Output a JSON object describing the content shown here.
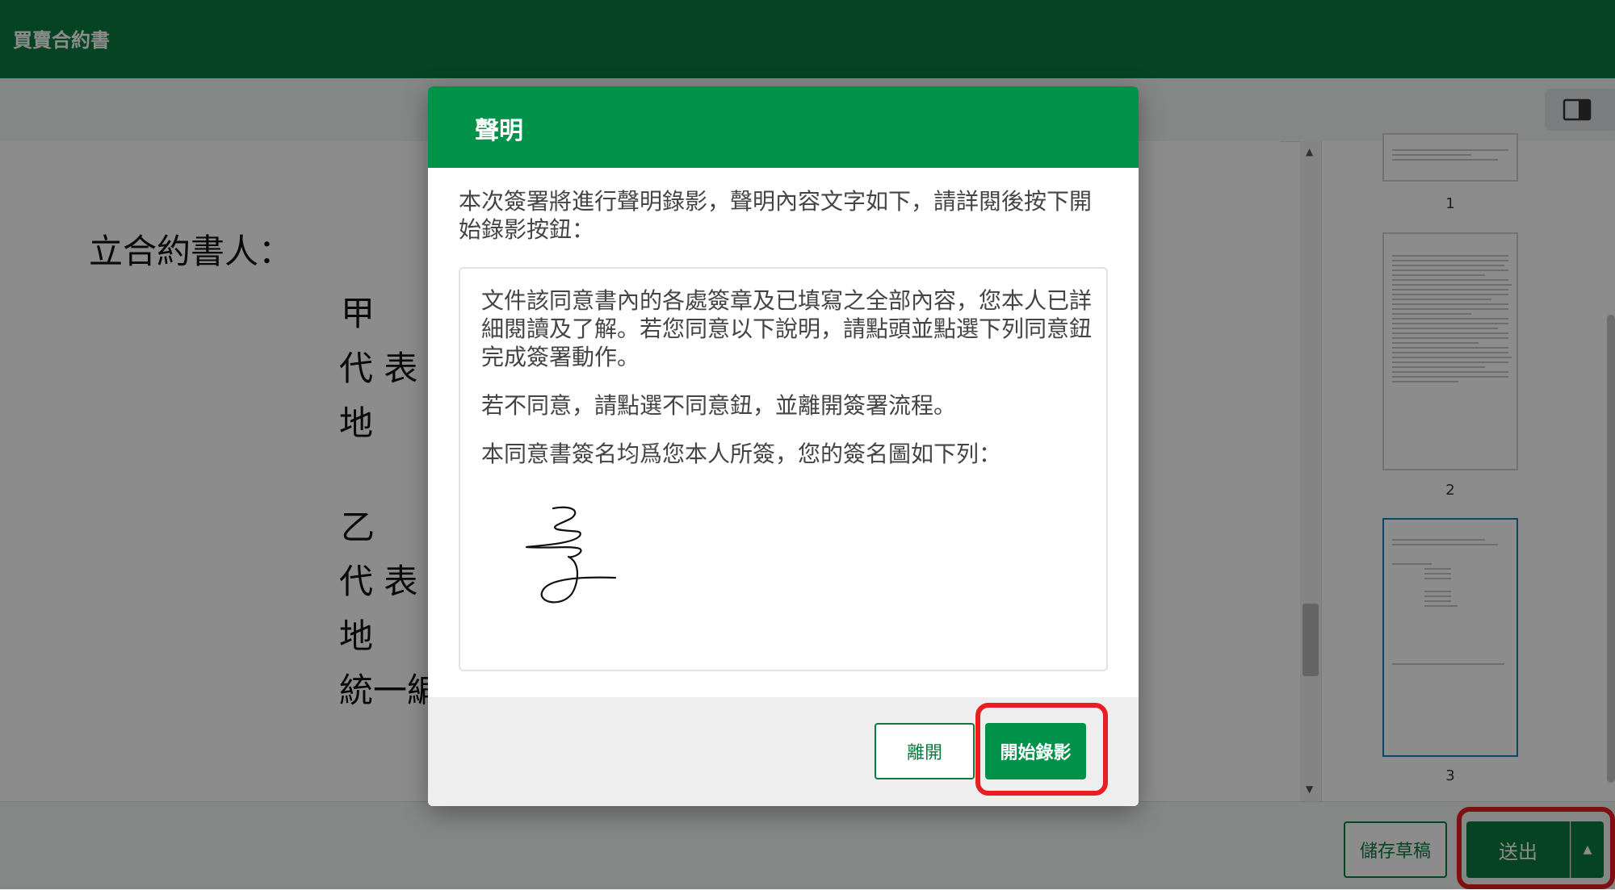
{
  "app": {
    "title": "買賣合約書"
  },
  "document": {
    "lines": [
      "立合約書人：",
      "甲",
      "代 表",
      "地",
      "乙",
      "代 表",
      "地",
      "統一編"
    ]
  },
  "thumbnails": [
    {
      "page": "1"
    },
    {
      "page": "2"
    },
    {
      "page": "3"
    }
  ],
  "footer": {
    "save_draft_label": "儲存草稿",
    "send_label": "送出"
  },
  "modal": {
    "title": "聲明",
    "intro": "本次簽署將進行聲明錄影，聲明內容文字如下，請詳閱後按下開始錄影按鈕：",
    "paragraphs": [
      "文件該同意書內的各處簽章及已填寫之全部內容，您本人已詳細閱讀及了解。若您同意以下說明，請點頭並點選下列同意鈕完成簽署動作。",
      "若不同意，請點選不同意鈕，並離開簽署流程。",
      "本同意書簽名均爲您本人所簽，您的簽名圖如下列："
    ],
    "leave_label": "離開",
    "start_label": "開始錄影"
  },
  "colors": {
    "brand": "#0a7a3e",
    "header": "#01924a",
    "highlight": "#ea1c24"
  },
  "icons": {
    "panel_toggle": "sidebar-panel-icon",
    "scroll_up": "triangle-up-icon",
    "scroll_down": "triangle-down-icon",
    "send_menu": "caret-up-icon"
  }
}
